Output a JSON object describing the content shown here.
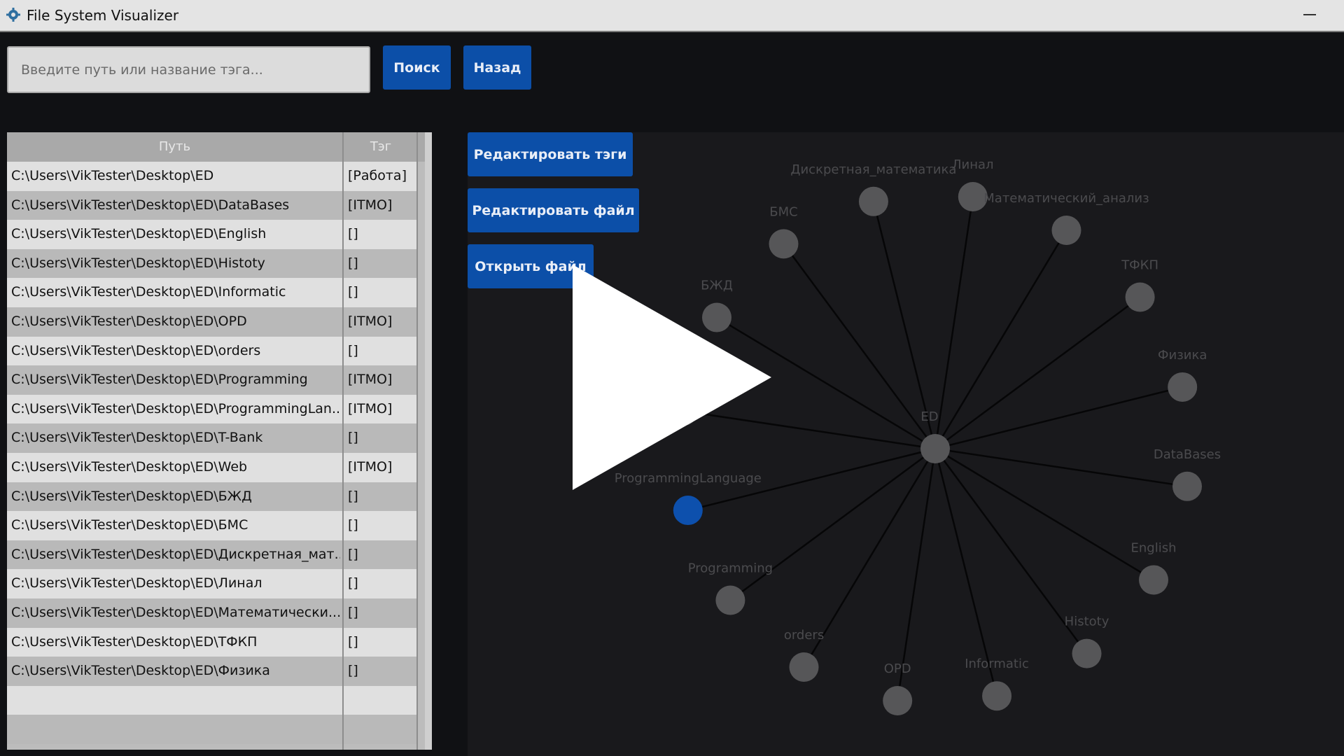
{
  "window": {
    "title": "File System Visualizer",
    "minimize_glyph": "—"
  },
  "search": {
    "placeholder": "Введите путь или название тэга...",
    "value": ""
  },
  "toolbar": {
    "search_label": "Поиск",
    "back_label": "Назад"
  },
  "actions": {
    "edit_tags_label": "Редактировать тэги",
    "edit_file_label": "Редактировать файл",
    "open_file_label": "Открыть файл"
  },
  "table": {
    "headers": {
      "path": "Путь",
      "tag": "Тэг"
    },
    "rows": [
      {
        "path": "C:\\Users\\VikTester\\Desktop\\ED",
        "tag": "[Работа]"
      },
      {
        "path": "C:\\Users\\VikTester\\Desktop\\ED\\DataBases",
        "tag": "[ITMO]"
      },
      {
        "path": "C:\\Users\\VikTester\\Desktop\\ED\\English",
        "tag": "[]"
      },
      {
        "path": "C:\\Users\\VikTester\\Desktop\\ED\\Histoty",
        "tag": "[]"
      },
      {
        "path": "C:\\Users\\VikTester\\Desktop\\ED\\Informatic",
        "tag": "[]"
      },
      {
        "path": "C:\\Users\\VikTester\\Desktop\\ED\\OPD",
        "tag": "[ITMO]"
      },
      {
        "path": "C:\\Users\\VikTester\\Desktop\\ED\\orders",
        "tag": "[]"
      },
      {
        "path": "C:\\Users\\VikTester\\Desktop\\ED\\Programming",
        "tag": "[ITMO]"
      },
      {
        "path": "C:\\Users\\VikTester\\Desktop\\ED\\ProgrammingLan...",
        "tag": "[ITMO]"
      },
      {
        "path": "C:\\Users\\VikTester\\Desktop\\ED\\T-Bank",
        "tag": "[]"
      },
      {
        "path": "C:\\Users\\VikTester\\Desktop\\ED\\Web",
        "tag": "[ITMO]"
      },
      {
        "path": "C:\\Users\\VikTester\\Desktop\\ED\\БЖД",
        "tag": "[]"
      },
      {
        "path": "C:\\Users\\VikTester\\Desktop\\ED\\БМС",
        "tag": "[]"
      },
      {
        "path": "C:\\Users\\VikTester\\Desktop\\ED\\Дискретная_мат...",
        "tag": "[]"
      },
      {
        "path": "C:\\Users\\VikTester\\Desktop\\ED\\Линал",
        "tag": "[]"
      },
      {
        "path": "C:\\Users\\VikTester\\Desktop\\ED\\Математически...",
        "tag": "[]"
      },
      {
        "path": "C:\\Users\\VikTester\\Desktop\\ED\\ТФКП",
        "tag": "[]"
      },
      {
        "path": "C:\\Users\\VikTester\\Desktop\\ED\\Физика",
        "tag": "[]"
      },
      {
        "path": "",
        "tag": ""
      },
      {
        "path": "",
        "tag": ""
      }
    ]
  },
  "graph": {
    "center": {
      "label": "ED"
    },
    "children": [
      {
        "label": "Дискретная_математика",
        "selected": false
      },
      {
        "label": "Линал",
        "selected": false
      },
      {
        "label": "Математический_анализ",
        "selected": false
      },
      {
        "label": "ТФКП",
        "selected": false
      },
      {
        "label": "Физика",
        "selected": false
      },
      {
        "label": "DataBases",
        "selected": false
      },
      {
        "label": "English",
        "selected": false
      },
      {
        "label": "Histoty",
        "selected": false
      },
      {
        "label": "Informatic",
        "selected": false
      },
      {
        "label": "OPD",
        "selected": false
      },
      {
        "label": "orders",
        "selected": false
      },
      {
        "label": "Programming",
        "selected": false
      },
      {
        "label": "ProgrammingLanguage",
        "selected": true
      },
      {
        "label": "T-Bank",
        "selected": false
      },
      {
        "label": "БЖД",
        "selected": false
      },
      {
        "label": "БМС",
        "selected": false
      }
    ]
  },
  "colors": {
    "accent": "#0c4fa8",
    "node": "#565658",
    "edge": "#060607",
    "selected_node": "#0d50ad",
    "selected_label": "#0f4ea6"
  },
  "overlay": {
    "icon": "play-icon"
  }
}
